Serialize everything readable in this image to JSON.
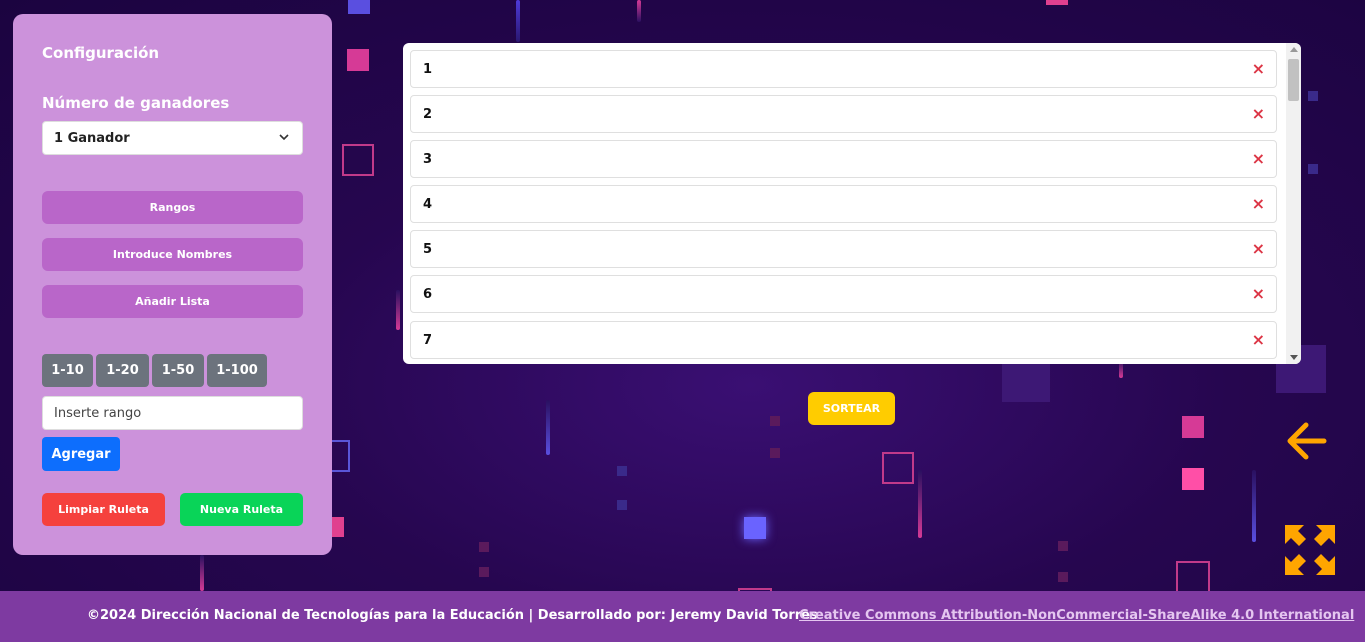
{
  "sidebar": {
    "title": "Configuración",
    "winners_label": "Número de ganadores",
    "winners_select": "1 Ganador",
    "mode_buttons": [
      "Rangos",
      "Introduce Nombres",
      "Añadir Lista"
    ],
    "range_buttons": [
      "1-10",
      "1-20",
      "1-50",
      "1-100"
    ],
    "range_input_placeholder": "Inserte rango",
    "add_button": "Agregar",
    "clear_button": "Limpiar Ruleta",
    "new_button": "Nueva Ruleta"
  },
  "list": {
    "items": [
      "1",
      "2",
      "3",
      "4",
      "5",
      "6",
      "7"
    ],
    "delete_glyph": "×"
  },
  "draw_button": "SORTEAR",
  "icons": {
    "back": "arrow-left-icon",
    "fullscreen": "expand-arrows-icon"
  },
  "colors": {
    "sidebar": "#cc92db",
    "accent_purple": "#b966c9",
    "draw": "#ffcc00",
    "arrow": "#ffa500",
    "clear": "#f5413d",
    "new": "#09d458",
    "add": "#0d6efd",
    "footer": "#7e3aa1"
  },
  "footer": {
    "text": "©2024 Dirección Nacional de Tecnologías para la Educación | Desarrollado por: Jeremy David Torres",
    "license_link": "Creative Commons Attribution-NonCommercial-ShareAlike 4.0 International"
  }
}
